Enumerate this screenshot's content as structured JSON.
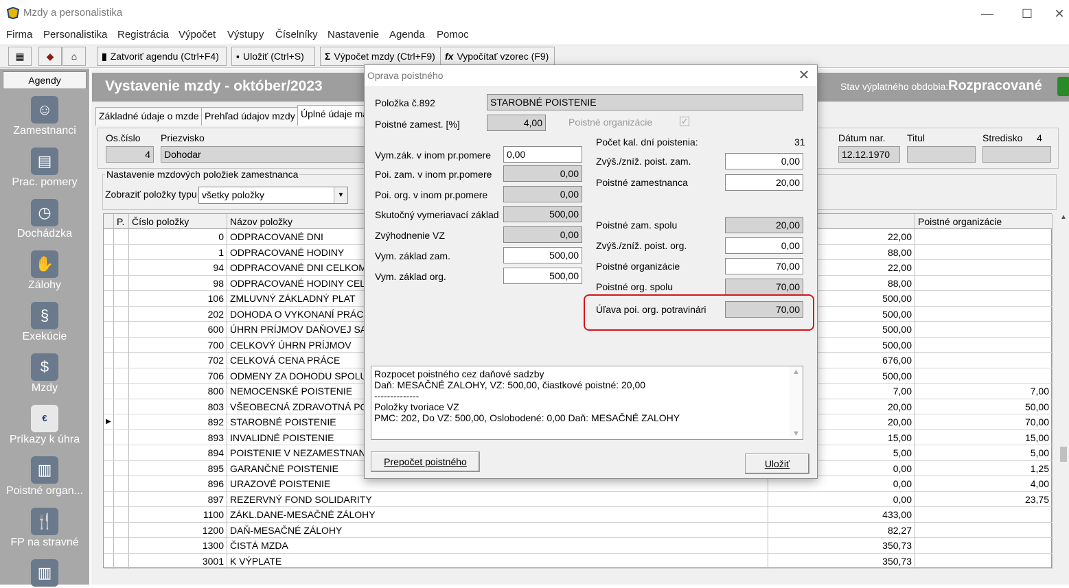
{
  "app": {
    "title": "Mzdy a personalistika",
    "minimize": "—",
    "maximize": "☐",
    "close": "✕"
  },
  "menu": [
    "Firma",
    "Personalistika",
    "Registrácia",
    "Výpočet",
    "Výstupy",
    "Číselníky",
    "Nastavenie",
    "Agenda",
    "Pomoc"
  ],
  "toolbar": {
    "close_agenda": "Zatvoriť agendu (Ctrl+F4)",
    "save": "Uložiť (Ctrl+S)",
    "calc_salary": "Výpočet mzdy (Ctrl+F9)",
    "calc_formula": "Vypočítať vzorec (F9)"
  },
  "sidebar": {
    "header": "Agendy",
    "items": [
      "Zamestnanci",
      "Prac. pomery",
      "Dochádzka",
      "Zálohy",
      "Exekúcie",
      "Mzdy",
      "Príkazy k úhra",
      "Poistné organ...",
      "FP na stravné"
    ]
  },
  "header": {
    "title": "Vystavenie mzdy -  október/2023",
    "status_label": "Stav výplatného obdobia:",
    "status_value": "Rozpracované"
  },
  "tabs": [
    "Základné údaje o mzde",
    "Prehľad údajov mzdy",
    "Úplné údaje ma"
  ],
  "employee": {
    "os_cislo_label": "Os.číslo",
    "os_cislo": "4",
    "priezvisko_label": "Priezvisko",
    "priezvisko": "Dohodar",
    "datum_nar_label": "Dátum nar.",
    "datum_nar": "12.12.1970",
    "titul_label": "Titul",
    "titul": "",
    "stredisko_label": "Stredisko",
    "stredisko": "4"
  },
  "settings": {
    "legend": "Nastavenie mzdových položiek zamestnanca",
    "filter_label": "Zobraziť položky typu",
    "filter_value": "všetky položky"
  },
  "grid": {
    "columns": {
      "p": "P.",
      "cislo": "Číslo položky",
      "nazov": "Názov položky",
      "poistne_org": "Poistné organizácie"
    },
    "rows": [
      {
        "cislo": "0",
        "nazov": "ODPRACOVANÉ DNI",
        "hodnota": "22,00",
        "org": ""
      },
      {
        "cislo": "1",
        "nazov": "ODPRACOVANÉ HODINY",
        "hodnota": "88,00",
        "org": ""
      },
      {
        "cislo": "94",
        "nazov": "ODPRACOVANÉ DNI CELKOM",
        "hodnota": "22,00",
        "org": ""
      },
      {
        "cislo": "98",
        "nazov": "ODPRACOVANÉ HODINY CELK",
        "hodnota": "88,00",
        "org": ""
      },
      {
        "cislo": "106",
        "nazov": "ZMLUVNÝ ZÁKLADNÝ PLAT",
        "hodnota": "500,00",
        "org": ""
      },
      {
        "cislo": "202",
        "nazov": "DOHODA O VYKONANÍ PRÁCE",
        "hodnota": "500,00",
        "org": ""
      },
      {
        "cislo": "600",
        "nazov": "ÚHRN PRÍJMOV DAŇOVEJ SAD",
        "hodnota": "500,00",
        "org": ""
      },
      {
        "cislo": "700",
        "nazov": "CELKOVÝ ÚHRN PRÍJMOV",
        "hodnota": "500,00",
        "org": ""
      },
      {
        "cislo": "702",
        "nazov": "CELKOVÁ CENA PRÁCE",
        "hodnota": "676,00",
        "org": ""
      },
      {
        "cislo": "706",
        "nazov": "ODMENY ZA DOHODU SPOLU",
        "hodnota": "500,00",
        "org": ""
      },
      {
        "cislo": "800",
        "nazov": "NEMOCENSKÉ POISTENIE",
        "hodnota": "7,00",
        "org": "7,00"
      },
      {
        "cislo": "803",
        "nazov": "VŠEOBECNÁ ZDRAVOTNÁ POI",
        "hodnota": "20,00",
        "org": "50,00"
      },
      {
        "cislo": "892",
        "nazov": "STAROBNÉ POISTENIE",
        "hodnota": "20,00",
        "org": "70,00"
      },
      {
        "cislo": "893",
        "nazov": "INVALIDNÉ POISTENIE",
        "hodnota": "15,00",
        "org": "15,00"
      },
      {
        "cislo": "894",
        "nazov": "POISTENIE V NEZAMESTNANO",
        "hodnota": "5,00",
        "org": "5,00"
      },
      {
        "cislo": "895",
        "nazov": "GARANČNÉ POISTENIE",
        "hodnota": "0,00",
        "org": "1,25"
      },
      {
        "cislo": "896",
        "nazov": "URAZOVÉ POISTENIE",
        "hodnota": "0,00",
        "org": "4,00"
      },
      {
        "cislo": "897",
        "nazov": "REZERVNÝ FOND SOLIDARITY",
        "hodnota": "0,00",
        "org": "23,75"
      },
      {
        "cislo": "1100",
        "nazov": "ZÁKL.DANE-MESAČNÉ ZÁLOHY",
        "hodnota": "433,00",
        "org": ""
      },
      {
        "cislo": "1200",
        "nazov": "DAŇ-MESAČNÉ ZÁLOHY",
        "hodnota": "82,27",
        "org": ""
      },
      {
        "cislo": "1300",
        "nazov": "ČISTÁ MZDA",
        "hodnota": "350,73",
        "org": ""
      },
      {
        "cislo": "3001",
        "nazov": "K VÝPLATE",
        "hodnota": "350,73",
        "org": ""
      }
    ],
    "selected_row": 12
  },
  "dialog": {
    "title": "Oprava poistného",
    "polozka_label": "Položka č.892",
    "polozka_value": "STAROBNÉ POISTENIE",
    "poistne_zamest_label": "Poistné zamest. [%]",
    "poistne_zamest_value": "4,00",
    "poistne_org_label": "Poistné organizácie",
    "poistne_org_checked": "✓",
    "left": [
      {
        "label": "Vym.zák. v inom pr.pomere",
        "value": "0,00"
      },
      {
        "label": "Poi. zam. v inom pr.pomere",
        "value": "0,00"
      },
      {
        "label": "Poi. org. v inom pr.pomere",
        "value": "0,00"
      },
      {
        "label": "Skutočný vymeriavací základ",
        "value": "500,00"
      },
      {
        "label": "Zvýhodnenie VZ",
        "value": "0,00"
      },
      {
        "label": "Vym. základ zam.",
        "value": "500,00"
      },
      {
        "label": "Vym. základ org.",
        "value": "500,00"
      }
    ],
    "pocet_dni_label": "Počet kal. dní poistenia:",
    "pocet_dni_value": "31",
    "right": [
      {
        "label": "Zvýš./zníž. poist. zam.",
        "value": "0,00"
      },
      {
        "label": "Poistné zamestnanca",
        "value": "20,00"
      },
      {
        "label": "Poistné zam. spolu",
        "value": "20,00"
      },
      {
        "label": "Zvýš./zníž. poist. org.",
        "value": "0,00"
      },
      {
        "label": "Poistné organizácie",
        "value": "70,00"
      },
      {
        "label": "Poistné org. spolu",
        "value": "70,00"
      },
      {
        "label": "Úľava poi. org. potravinári",
        "value": "70,00"
      }
    ],
    "calc_text": "Rozpocet poistného cez daňové sadzby\nDaň: MESAČNÉ ZALOHY, VZ: 500,00, čiastkové poistné: 20,00\n--------------\nPoložky tvoriace VZ\nPMC: 202, Do VZ: 500,00, Oslobodené: 0,00 Daň: MESAČNÉ ZALOHY",
    "recalc_button": "Prepočet  poistného",
    "save_button": "Uložiť"
  },
  "colors": {
    "sidebar": "#a8a8a8",
    "header_bar": "#9e9e9e",
    "highlight": "#d7141a"
  }
}
